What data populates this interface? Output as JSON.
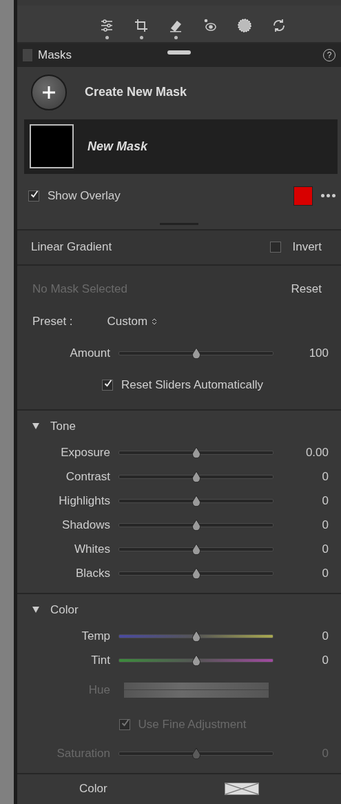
{
  "toolbar": {
    "tools": [
      {
        "edited": true
      },
      {
        "edited": true
      },
      {
        "edited": true
      },
      {
        "edited": false
      },
      {
        "edited": false
      },
      {
        "edited": false
      }
    ]
  },
  "masks": {
    "title": "Masks",
    "help": "?",
    "create_label": "Create New Mask",
    "items": [
      {
        "name": "New Mask",
        "selected": true
      }
    ],
    "show_overlay": {
      "label": "Show Overlay",
      "checked": true
    }
  },
  "mask_type": {
    "title": "Linear Gradient",
    "invert": {
      "label": "Invert",
      "checked": false
    }
  },
  "status": {
    "text": "No Mask Selected",
    "disabled": true
  },
  "reset": "Reset",
  "preset": {
    "label": "Preset :",
    "value": "Custom"
  },
  "amount": {
    "label": "Amount",
    "value": "100",
    "level": 0.5,
    "disabled": false
  },
  "reset_sliders": {
    "label": "Reset Sliders Automatically",
    "checked": true
  },
  "sections": [
    {
      "title": "Tone",
      "expanded": true,
      "rows": [
        {
          "kind": "slider",
          "label": "Exposure",
          "value": "0.00",
          "level": 0.5,
          "disabled": false
        },
        {
          "kind": "slider",
          "label": "Contrast",
          "value": "0",
          "level": 0.5,
          "disabled": false
        },
        {
          "kind": "slider",
          "label": "Highlights",
          "value": "0",
          "level": 0.5,
          "disabled": false
        },
        {
          "kind": "slider",
          "label": "Shadows",
          "value": "0",
          "level": 0.5,
          "disabled": false
        },
        {
          "kind": "slider",
          "label": "Whites",
          "value": "0",
          "level": 0.5,
          "disabled": false
        },
        {
          "kind": "slider",
          "label": "Blacks",
          "value": "0",
          "level": 0.5,
          "disabled": false
        }
      ]
    },
    {
      "title": "Color",
      "expanded": true,
      "rows": [
        {
          "kind": "temp",
          "label": "Temp",
          "value": "0",
          "level": 0.5,
          "disabled": false
        },
        {
          "kind": "tint",
          "label": "Tint",
          "value": "0",
          "level": 0.5,
          "disabled": false
        },
        {
          "kind": "hue",
          "label": "Hue",
          "disabled": true
        },
        {
          "kind": "checkbox",
          "label": "Use Fine Adjustment",
          "checked": true,
          "disabled": true
        },
        {
          "kind": "slider",
          "label": "Saturation",
          "value": "0",
          "level": 0.5,
          "disabled": true
        }
      ]
    }
  ],
  "footer": {
    "label": "Color"
  }
}
